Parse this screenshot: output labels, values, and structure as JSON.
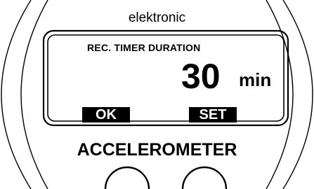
{
  "brand": "elektronic",
  "screen": {
    "label": "REC. TIMER DURATION",
    "value": "30",
    "unit": "min"
  },
  "softkeys": {
    "left": "OK",
    "right": "SET"
  },
  "device_name": "ACCELEROMETER",
  "buttons": [
    "left-button",
    "right-button"
  ],
  "colors": {
    "background": "#ffffff",
    "ink": "#000000",
    "softkey_text": "#ffffff"
  }
}
